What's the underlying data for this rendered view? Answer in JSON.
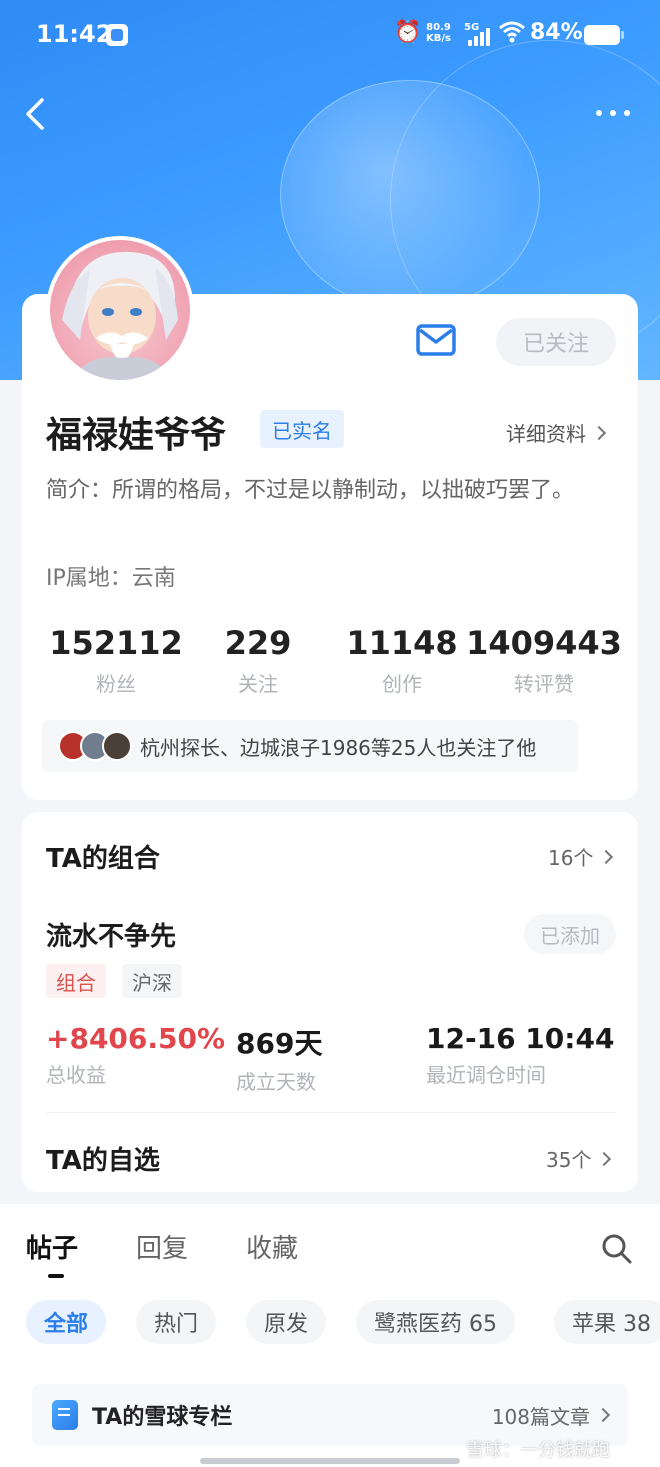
{
  "status_bar": {
    "time": "11:42",
    "net_speed_value": "80.9",
    "net_speed_unit": "KB/s",
    "network": "5G",
    "battery": "84%"
  },
  "profile": {
    "follow_button": "已关注",
    "name": "福禄娃爷爷",
    "verified_badge": "已实名",
    "detail_link": "详细资料",
    "bio": "简介：所谓的格局，不过是以静制动，以拙破巧罢了。",
    "ip": "IP属地：云南",
    "stats": [
      {
        "value": "152112",
        "label": "粉丝"
      },
      {
        "value": "229",
        "label": "关注"
      },
      {
        "value": "11148",
        "label": "创作"
      },
      {
        "value": "1409443",
        "label": "转评赞"
      }
    ],
    "mutual_followers": "杭州探长、边城浪子1986等25人也关注了他"
  },
  "portfolio": {
    "title": "TA的组合",
    "count": "16个",
    "name": "流水不争先",
    "added_button": "已添加",
    "tags": [
      "组合",
      "沪深"
    ],
    "metrics": [
      {
        "value": "+8406.50%",
        "label": "总收益"
      },
      {
        "value": "869天",
        "label": "成立天数"
      },
      {
        "value": "12-16 10:44",
        "label": "最近调仓时间"
      }
    ],
    "watchlist_title": "TA的自选",
    "watchlist_count": "35个"
  },
  "tabs": [
    "帖子",
    "回复",
    "收藏"
  ],
  "chips": [
    "全部",
    "热门",
    "原发",
    "鹭燕医药 65",
    "苹果 38"
  ],
  "column": {
    "title": "TA的雪球专栏",
    "count": "108篇文章"
  },
  "watermark": "雪球：一分钱就跑",
  "colors": {
    "accent": "#2b7de9",
    "gain": "#e0464b",
    "hero": "#3d9cff"
  }
}
